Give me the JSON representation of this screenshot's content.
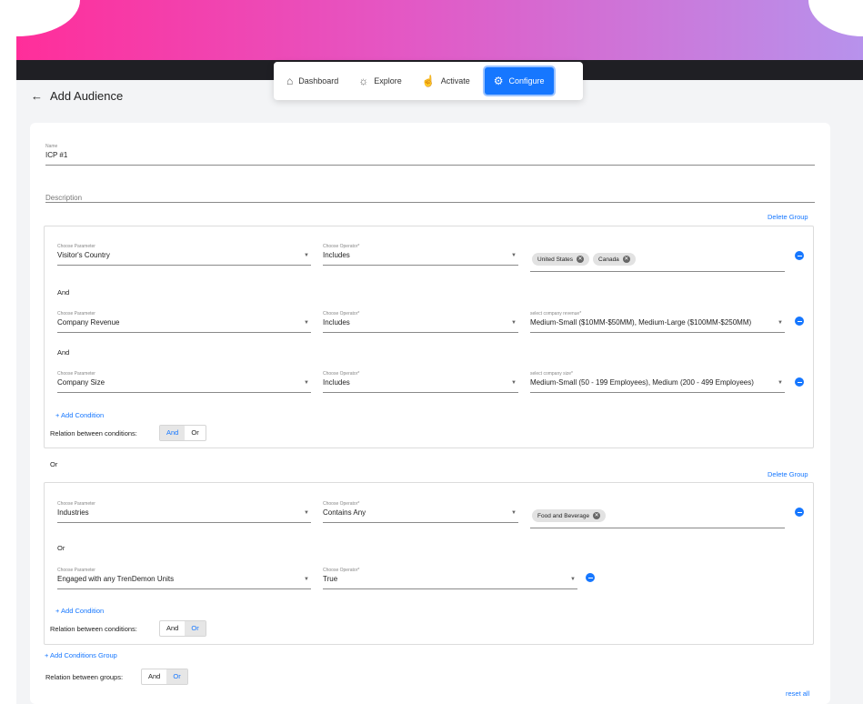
{
  "nav": {
    "items": [
      {
        "label": "Dashboard",
        "icon": "home-icon"
      },
      {
        "label": "Explore",
        "icon": "telescope-icon"
      },
      {
        "label": "Activate",
        "icon": "click-icon"
      },
      {
        "label": "Configure",
        "icon": "gears-icon"
      }
    ],
    "active": "Configure"
  },
  "page": {
    "title": "Add Audience",
    "back": "←"
  },
  "form": {
    "name_label": "Name",
    "name_value": "ICP #1",
    "description_placeholder": "Description"
  },
  "groups": [
    {
      "delete_label": "Delete Group",
      "conditions": [
        {
          "param_label": "Choose Parameter",
          "param": "Visitor's Country",
          "op_label": "Choose Operator*",
          "op": "Includes",
          "chips": [
            "United States",
            "Canada"
          ]
        },
        {
          "connector": "And",
          "param_label": "Choose Parameter",
          "param": "Company Revenue",
          "op_label": "Choose Operator*",
          "op": "Includes",
          "value_label": "select company revenue*",
          "value": "Medium-Small ($10MM-$50MM), Medium-Large ($100MM-$250MM)"
        },
        {
          "connector": "And",
          "param_label": "Choose Parameter",
          "param": "Company Size",
          "op_label": "Choose Operator*",
          "op": "Includes",
          "value_label": "select company size*",
          "value": "Medium-Small (50 - 199 Employees), Medium (200 - 499 Employees)"
        }
      ],
      "add_condition": "+ Add Condition",
      "relation_label": "Relation between conditions:",
      "relation": {
        "and": "And",
        "or": "Or",
        "selected": "And"
      }
    },
    {
      "delete_label": "Delete Group",
      "conditions": [
        {
          "param_label": "Choose Parameter",
          "param": "Industries",
          "op_label": "Choose Operator*",
          "op": "Contains Any",
          "chips": [
            "Food and Beverage"
          ]
        },
        {
          "connector": "Or",
          "param_label": "Choose Parameter",
          "param": "Engaged with any TrenDemon Units",
          "op_label": "Choose Operator*",
          "op": "True"
        }
      ],
      "add_condition": "+ Add Condition",
      "relation_label": "Relation between conditions:",
      "relation": {
        "and": "And",
        "or": "Or",
        "selected": "Or"
      }
    }
  ],
  "between_groups": "Or",
  "add_group": "+ Add Conditions Group",
  "groups_relation_label": "Relation between groups:",
  "groups_relation": {
    "and": "And",
    "or": "Or",
    "selected": "Or"
  },
  "reset_all": "reset all",
  "colors": {
    "accent": "#1677ff",
    "gradient_start": "#ff2e9a",
    "gradient_end": "#b792ec"
  }
}
